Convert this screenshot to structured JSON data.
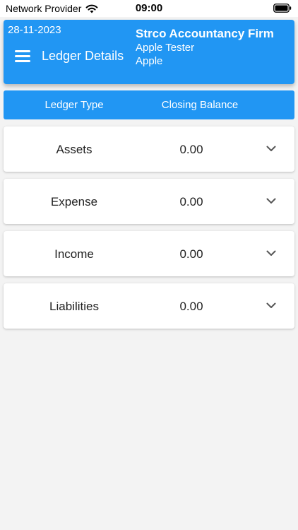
{
  "status_bar": {
    "carrier": "Network Provider",
    "time": "09:00",
    "wifi_icon": "wifi-icon",
    "battery_icon": "battery-icon"
  },
  "header": {
    "date": "28-11-2023",
    "title": "Ledger Details",
    "firm_name": "Strco Accountancy Firm",
    "user_name": "Apple Tester",
    "company": "Apple",
    "menu_icon": "hamburger-menu-icon",
    "color": "#2196f3"
  },
  "columns": {
    "ledger_type": "Ledger Type",
    "closing_balance": "Closing Balance"
  },
  "ledgers": [
    {
      "type": "Assets",
      "balance": "0.00"
    },
    {
      "type": "Expense",
      "balance": "0.00"
    },
    {
      "type": "Income",
      "balance": "0.00"
    },
    {
      "type": "Liabilities",
      "balance": "0.00"
    }
  ],
  "icons": {
    "row_expand": "chevron-down-icon"
  }
}
